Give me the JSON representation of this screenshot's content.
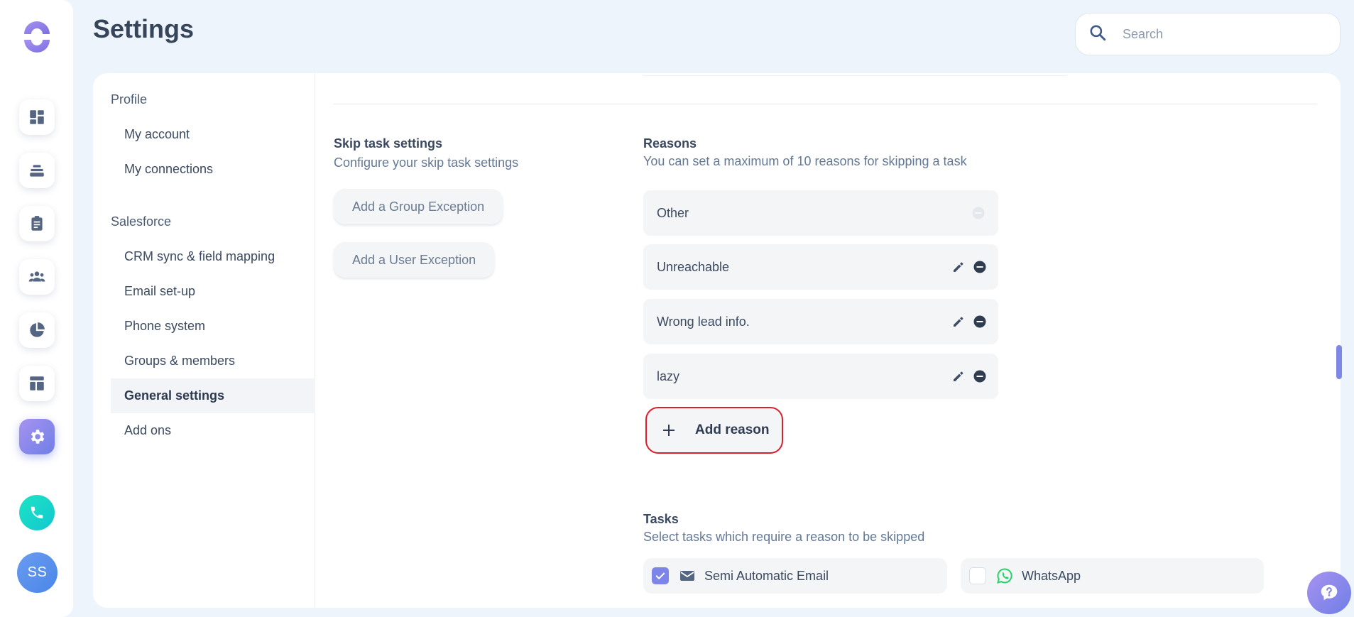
{
  "header": {
    "title": "Settings",
    "search_placeholder": "Search"
  },
  "rail": {
    "icons": [
      "logo-icon",
      "dashboard-icon",
      "stack-icon",
      "clipboard-icon",
      "people-icon",
      "pie-chart-icon",
      "layout-icon",
      "gear-icon",
      "phone-icon"
    ],
    "avatar_initials": "SS"
  },
  "subnav": {
    "profile_label": "Profile",
    "profile_items": [
      "My account",
      "My connections"
    ],
    "salesforce_label": "Salesforce",
    "salesforce_items": [
      "CRM sync & field mapping",
      "Email set-up",
      "Phone system",
      "Groups & members",
      "General settings",
      "Add ons"
    ],
    "active_item": "General settings"
  },
  "skip_task": {
    "title": "Skip task settings",
    "subtitle": "Configure your skip task settings",
    "group_exception_label": "Add a Group Exception",
    "user_exception_label": "Add a User Exception"
  },
  "reasons": {
    "title": "Reasons",
    "subtitle": "You can set a maximum of 10 reasons for skipping a task",
    "items": [
      {
        "label": "Other",
        "editable": false
      },
      {
        "label": "Unreachable",
        "editable": true
      },
      {
        "label": "Wrong lead info.",
        "editable": true
      },
      {
        "label": "lazy",
        "editable": true
      }
    ],
    "add_label": "Add reason"
  },
  "tasks": {
    "title": "Tasks",
    "subtitle": "Select tasks which require a reason to be skipped",
    "items": [
      {
        "label": "Semi Automatic Email",
        "checked": true,
        "icon": "mail-icon"
      },
      {
        "label": "WhatsApp",
        "checked": false,
        "icon": "whatsapp-icon"
      }
    ]
  },
  "colors": {
    "accent": "#7d86e8",
    "highlight_border": "#d7202c",
    "phone_button": "#1ee3c4",
    "whatsapp": "#25d366"
  }
}
